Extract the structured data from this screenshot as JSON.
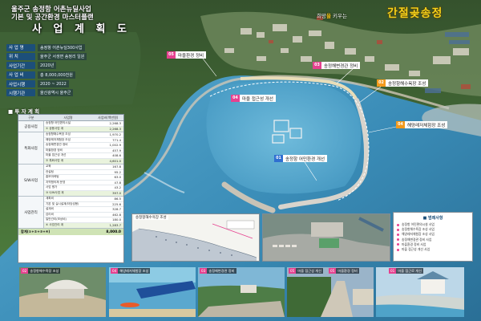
{
  "header": {
    "line1": "울주군 송정항 어촌뉴딜사업",
    "line2": "기본 및 공간환경 마스터플랜",
    "title": "사 업 계 획 도",
    "slogan_pre": "희망",
    "slogan_accent": "을",
    "slogan_post": " 키우는",
    "brand_name": "간절곶송정"
  },
  "overview": {
    "rows": [
      {
        "label": "사 업 명",
        "value": "송정항 어촌뉴딜300사업"
      },
      {
        "label": "위 치",
        "value": "울주군 서생면 송정리 일원"
      },
      {
        "label": "사업기간",
        "value": "2020년"
      },
      {
        "label": "사 업 비",
        "value": "총 8,000,000천원"
      },
      {
        "label": "사업시행",
        "value": "2020 ~ 2022"
      },
      {
        "label": "시행기관",
        "value": "울산광역시 울주군"
      }
    ]
  },
  "investment": {
    "heading": "■ 투 자 계 획",
    "col_headers": [
      "구분",
      "사업명",
      "사업비(백만원)"
    ],
    "groups": [
      {
        "label": "공용사업",
        "rows": [
          {
            "name": "송정항 어민편의시설",
            "value": "2,268.3"
          },
          {
            "name": "① 공용사업 계",
            "value": "2,268.3",
            "sub": true
          }
        ]
      },
      {
        "label": "특화사업",
        "rows": [
          {
            "name": "송정항해수욕장 조성",
            "value": "1,970.2"
          },
          {
            "name": "해양레저체험장 조성",
            "value": "771.4"
          },
          {
            "name": "송정해변경관 정비",
            "value": "1,002.9"
          },
          {
            "name": "마을환경 정비",
            "value": "457.9"
          },
          {
            "name": "마을 접근성 개선",
            "value": "408.6"
          },
          {
            "name": "② 특화사업 계",
            "value": "4,601.0",
            "sub": true
          }
        ]
      },
      {
        "label": "S/W사업",
        "rows": [
          {
            "name": "교육",
            "value": "167.8"
          },
          {
            "name": "컨설팅",
            "value": "95.2"
          },
          {
            "name": "홍보마케팅",
            "value": "63.0"
          },
          {
            "name": "지역협의체 운영",
            "value": "47.8"
          },
          {
            "name": "사업 평가",
            "value": "43.2"
          },
          {
            "name": "③ S/W사업 계",
            "value": "397.0",
            "sub": true
          }
        ]
      },
      {
        "label": "사업관리",
        "rows": [
          {
            "name": "계획비",
            "value": "86.5"
          },
          {
            "name": "기본 및 실시설계(타당성용)",
            "value": "225.6"
          },
          {
            "name": "설계비",
            "value": "328.7"
          },
          {
            "name": "감리비",
            "value": "462.8"
          },
          {
            "name": "일반관리(보상비)",
            "value": "180.0"
          },
          {
            "name": "④ 사업관리 계",
            "value": "1,283.7",
            "sub": true
          }
        ]
      }
    ],
    "total_label": "합계(①+②+③+④)",
    "total_value": "8,000.0"
  },
  "map_labels": [
    {
      "num": "05",
      "text": "마을환경 정비",
      "color": "pink"
    },
    {
      "num": "03",
      "text": "송정해변경관 정비",
      "color": "pink"
    },
    {
      "num": "02",
      "text": "송정항해수욕장 조성",
      "color": "orange"
    },
    {
      "num": "04",
      "text": "마을 접근성 개선",
      "color": "pink"
    },
    {
      "num": "04",
      "text": "해양레저체험장 조성",
      "color": "orange"
    },
    {
      "num": "01",
      "text": "송정항 어민환경 개선",
      "color": "blue"
    }
  ],
  "panels": {
    "beach_plan": "송정항해수욕장 조성",
    "legend_title": "■ 범례사항",
    "legend_items": [
      "송정항 어민편의시설 사업",
      "송정항해수욕장 조성 사업",
      "해양레저체험장 조성 사업",
      "송정해변경관 정비 사업",
      "마을환경 정비 사업",
      "마을 접근성 개선 사업"
    ]
  },
  "bottom_photos": [
    {
      "num": "02",
      "text": "송정항해수욕장 조성"
    },
    {
      "num": "04",
      "text": "해양레저체험장 조성"
    },
    {
      "num": "03",
      "text": "송정해변경관 정비"
    },
    {
      "num": "05",
      "text": "마을 접근성 개선"
    },
    {
      "num": "05",
      "text": "마을환경 정비"
    },
    {
      "num": "01",
      "text": "마을 접근로 개선"
    }
  ],
  "colors": {
    "sea": "#3d8fb8",
    "land": "#3e6a34",
    "accent_pink": "#e6418f",
    "accent_blue": "#2f6fd1",
    "accent_orange": "#f39a1c",
    "brand_yellow": "#f7d21a"
  }
}
